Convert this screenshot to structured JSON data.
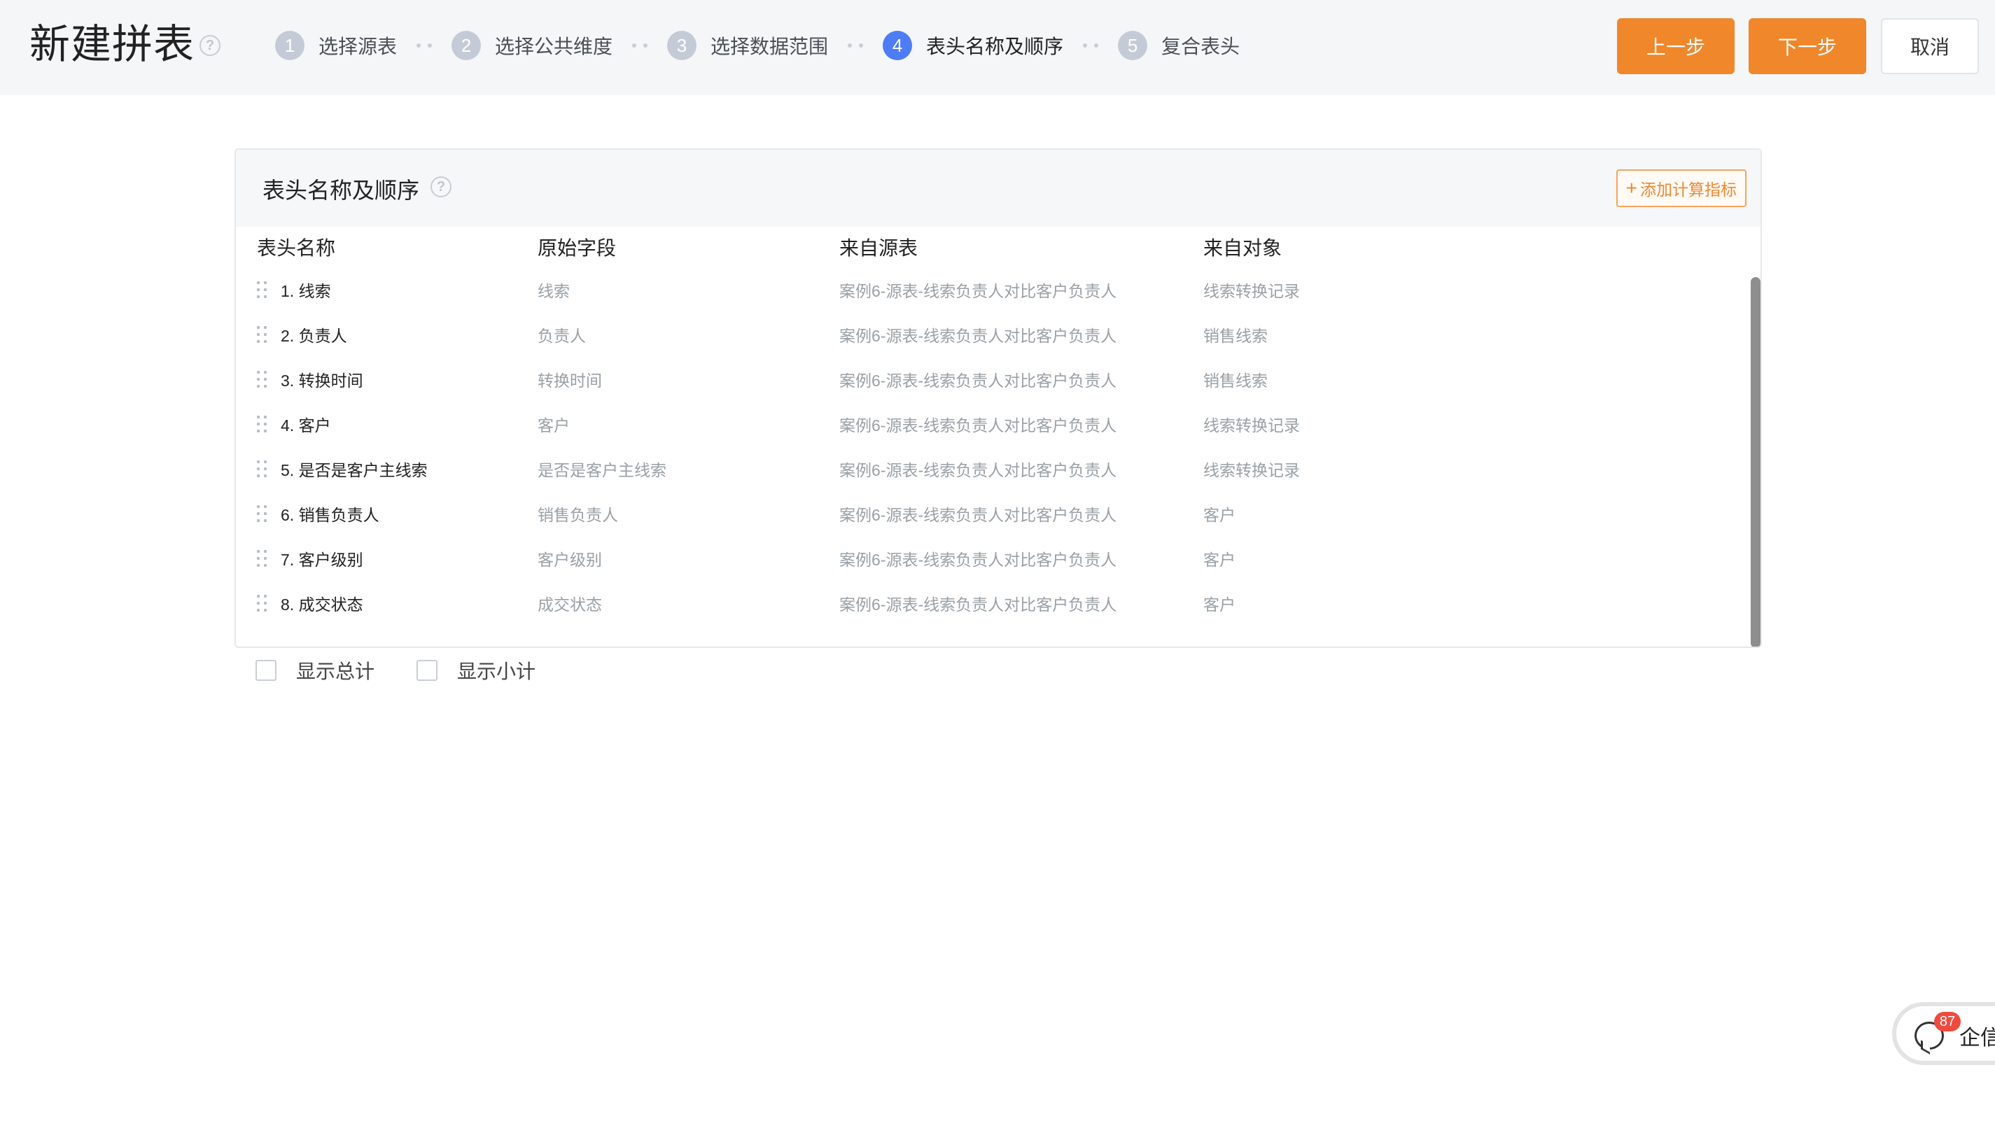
{
  "header": {
    "title": "新建拼表",
    "help_icon": "question-circle-icon",
    "steps": [
      {
        "num": "1",
        "label": "选择源表",
        "active": false
      },
      {
        "num": "2",
        "label": "选择公共维度",
        "active": false
      },
      {
        "num": "3",
        "label": "选择数据范围",
        "active": false
      },
      {
        "num": "4",
        "label": "表头名称及顺序",
        "active": true
      },
      {
        "num": "5",
        "label": "复合表头",
        "active": false
      }
    ],
    "buttons": {
      "prev": "上一步",
      "next": "下一步",
      "cancel": "取消"
    }
  },
  "panel": {
    "title": "表头名称及顺序",
    "add_metric": "添加计算指标",
    "columns": [
      "表头名称",
      "原始字段",
      "来自源表",
      "来自对象"
    ],
    "rows": [
      {
        "name": "1. 线索",
        "field": "线索",
        "source": "案例6-源表-线索负责人对比客户负责人",
        "object": "线索转换记录"
      },
      {
        "name": "2. 负责人",
        "field": "负责人",
        "source": "案例6-源表-线索负责人对比客户负责人",
        "object": "销售线索"
      },
      {
        "name": "3. 转换时间",
        "field": "转换时间",
        "source": "案例6-源表-线索负责人对比客户负责人",
        "object": "销售线索"
      },
      {
        "name": "4. 客户",
        "field": "客户",
        "source": "案例6-源表-线索负责人对比客户负责人",
        "object": "线索转换记录"
      },
      {
        "name": "5. 是否是客户主线索",
        "field": "是否是客户主线索",
        "source": "案例6-源表-线索负责人对比客户负责人",
        "object": "线索转换记录"
      },
      {
        "name": "6. 销售负责人",
        "field": "销售负责人",
        "source": "案例6-源表-线索负责人对比客户负责人",
        "object": "客户"
      },
      {
        "name": "7. 客户级别",
        "field": "客户级别",
        "source": "案例6-源表-线索负责人对比客户负责人",
        "object": "客户"
      },
      {
        "name": "8. 成交状态",
        "field": "成交状态",
        "source": "案例6-源表-线索负责人对比客户负责人",
        "object": "客户"
      }
    ]
  },
  "options": {
    "show_total": "显示总计",
    "show_subtotal": "显示小计"
  },
  "chat": {
    "badge": "87",
    "label": "企信"
  },
  "colors": {
    "accent": "#f0872b",
    "active_step": "#4e7cf6"
  }
}
